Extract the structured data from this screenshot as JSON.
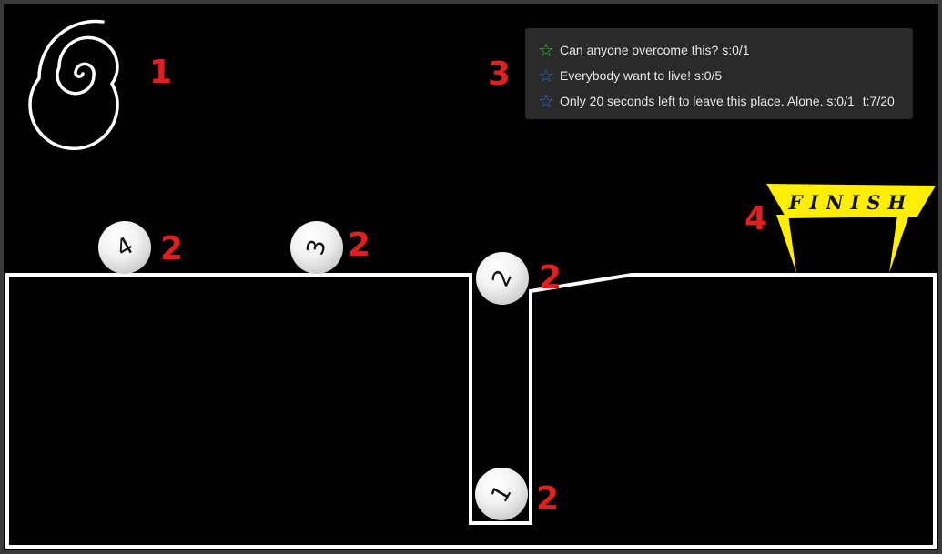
{
  "annotations": {
    "spiral": "1",
    "ball_4": "2",
    "ball_3": "2",
    "ball_2": "2",
    "ball_1": "2",
    "goals": "3",
    "finish": "4"
  },
  "balls": [
    {
      "number": "4"
    },
    {
      "number": "3"
    },
    {
      "number": "2"
    },
    {
      "number": "1"
    }
  ],
  "goals": [
    {
      "star_icon": "star-outline-icon",
      "star_color": "#2ecc2e",
      "text": "Can anyone overcome this? s:0/1",
      "extra": ""
    },
    {
      "star_icon": "star-outline-icon",
      "star_color": "#2a6fd6",
      "text": "Everybody want to live! s:0/5",
      "extra": ""
    },
    {
      "star_icon": "star-outline-icon",
      "star_color": "#2a6fd6",
      "text": "Only 20 seconds left to leave this place. Alone. s:0/1",
      "extra": "t:7/20"
    }
  ],
  "finish": {
    "label": "FINISH",
    "color": "#ffee00"
  },
  "colors": {
    "annotation": "#e02020",
    "track": "#ffffff",
    "background": "#000000"
  }
}
